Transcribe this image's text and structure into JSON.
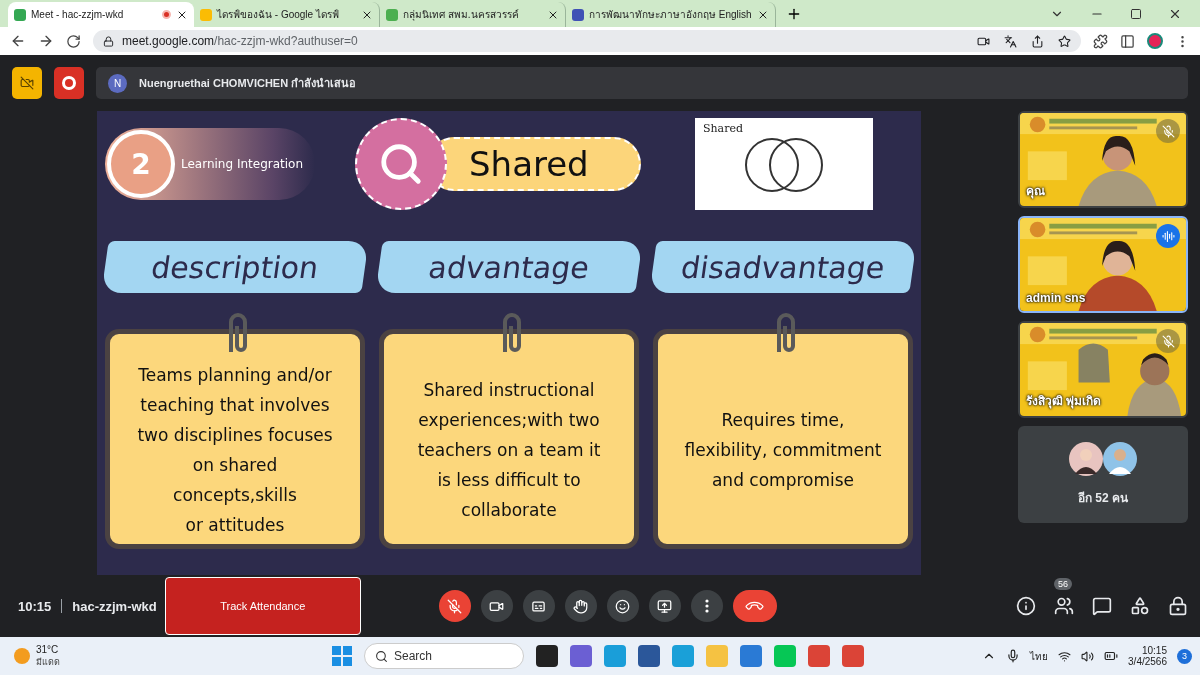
{
  "browser": {
    "tabs": [
      {
        "title": "Meet - hac-zzjm-wkd",
        "selected": true,
        "recording": true
      },
      {
        "title": "ไดรฟ์ของฉัน - Google ไดรฟ์",
        "selected": false,
        "recording": false
      },
      {
        "title": "กลุ่มนิเทศ สพม.นครสวรรค์",
        "selected": false,
        "recording": false
      },
      {
        "title": "การพัฒนาทักษะภาษาอังกฤษ English",
        "selected": false,
        "recording": false
      }
    ],
    "url_host": "meet.google.com",
    "url_path": "/hac-zzjm-wkd?authuser=0"
  },
  "meeting": {
    "presenter_initial": "N",
    "presenter_text": "Nuengruethai CHOMVICHEN กำลังนำเสนอ",
    "slide": {
      "number": "2",
      "section": "Learning Integration",
      "title": "Shared",
      "venn_label": "Shared",
      "columns": [
        {
          "heading": "description",
          "text": "Teams planning and/or\nteaching that involves\ntwo disciplines focuses\non shared\nconcepts,skills\nor attitudes"
        },
        {
          "heading": "advantage",
          "text": "Shared instructional\nexperiences;with two\nteachers on a team it\nis less difficult to\ncollaborate"
        },
        {
          "heading": "disadvantage",
          "text": "Requires time,\nflexibility, commitment\nand compromise"
        }
      ]
    },
    "tiles": [
      {
        "name": "คุณ",
        "muted": true,
        "speaking": false
      },
      {
        "name": "admin sns",
        "muted": false,
        "speaking": true
      },
      {
        "name": "รังสิวุฒิ พุ่มเกิด",
        "muted": true,
        "speaking": false
      }
    ],
    "more_label": "อีก 52 คน",
    "time": "10:15",
    "code": "hac-zzjm-wkd",
    "track_button": "Track Attendance",
    "mic_muted": true,
    "people_count": "56"
  },
  "taskbar": {
    "weather_temp": "31°C",
    "weather_text": "มีแดด",
    "search_placeholder": "Search",
    "lang": "ไทย",
    "time": "10:15",
    "date": "3/4/2566",
    "notification_count": "3"
  }
}
